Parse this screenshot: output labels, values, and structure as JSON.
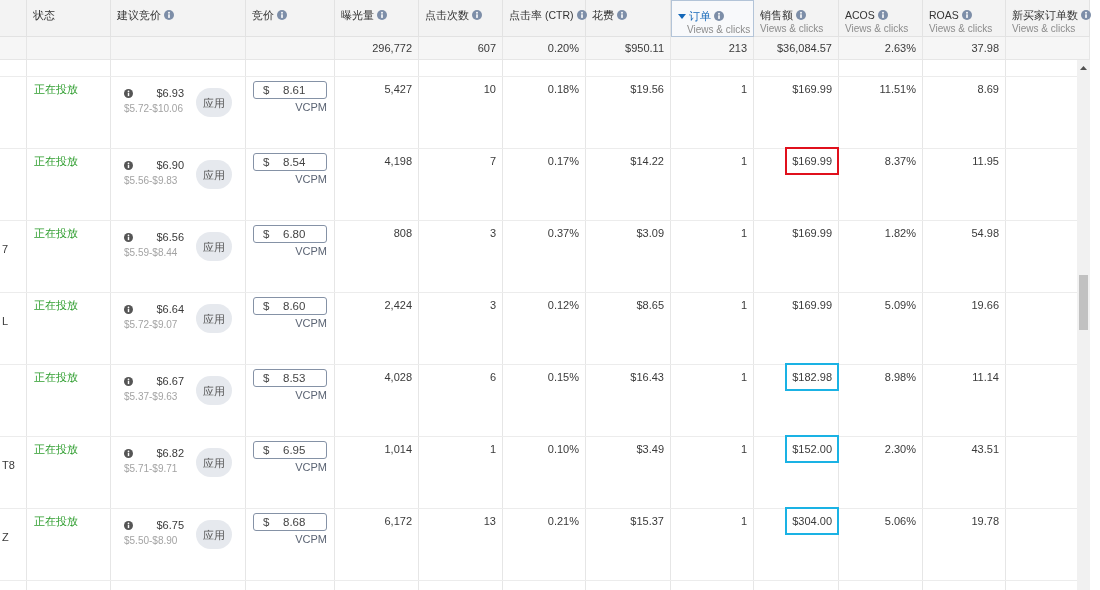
{
  "table": {
    "columns": [
      {
        "label": "状态",
        "info": false,
        "sorted": false
      },
      {
        "label": "建议竞价",
        "info": true,
        "sorted": false
      },
      {
        "label": "竞价",
        "info": true,
        "sorted": false
      },
      {
        "label": "曝光量",
        "info": true,
        "sorted": false
      },
      {
        "label": "点击次数",
        "info": true,
        "sorted": false
      },
      {
        "label": "点击率 (CTR)",
        "info": true,
        "sorted": false
      },
      {
        "label": "花费",
        "info": true,
        "sorted": false
      },
      {
        "label": "订单",
        "info": true,
        "sorted": true,
        "subtitle": "Views & clicks"
      },
      {
        "label": "销售额",
        "info": true,
        "sorted": false,
        "subtitle": "Views & clicks"
      },
      {
        "label": "ACOS",
        "info": true,
        "sorted": false,
        "subtitle": "Views & clicks"
      },
      {
        "label": "ROAS",
        "info": true,
        "sorted": false,
        "subtitle": "Views & clicks"
      },
      {
        "label": "新买家订单数",
        "info": true,
        "sorted": false,
        "subtitle": "Views & clicks"
      }
    ],
    "totals": {
      "impressions": "296,772",
      "clicks": "607",
      "ctr": "0.20%",
      "spend": "$950.11",
      "orders": "213",
      "sales": "$36,084.57",
      "acos": "2.63%",
      "roas": "37.98"
    },
    "rows": [
      {
        "status": "正在投放",
        "suggested_bid": "$6.93",
        "bid_range": "$5.72-$10.06",
        "apply_button": "应用",
        "currency": "$",
        "bid": "8.61",
        "bid_unit": "VCPM",
        "impressions": "5,427",
        "clicks": "10",
        "ctr": "0.18%",
        "spend": "$19.56",
        "orders": "1",
        "sales": "$169.99",
        "acos": "11.51%",
        "roas": "8.69"
      },
      {
        "status": "正在投放",
        "suggested_bid": "$6.90",
        "bid_range": "$5.56-$9.83",
        "apply_button": "应用",
        "currency": "$",
        "bid": "8.54",
        "bid_unit": "VCPM",
        "impressions": "4,198",
        "clicks": "7",
        "ctr": "0.17%",
        "spend": "$14.22",
        "orders": "1",
        "sales": "$169.99",
        "sales_mark": {
          "color": "#e0101c"
        },
        "acos": "8.37%",
        "roas": "11.95"
      },
      {
        "column_1": "7",
        "status": "正在投放",
        "suggested_bid": "$6.56",
        "bid_range": "$5.59-$8.44",
        "apply_button": "应用",
        "currency": "$",
        "bid": "6.80",
        "bid_unit": "VCPM",
        "impressions": "808",
        "clicks": "3",
        "ctr": "0.37%",
        "spend": "$3.09",
        "orders": "1",
        "sales": "$169.99",
        "acos": "1.82%",
        "roas": "54.98"
      },
      {
        "column_1": "L",
        "status": "正在投放",
        "suggested_bid": "$6.64",
        "bid_range": "$5.72-$9.07",
        "apply_button": "应用",
        "currency": "$",
        "bid": "8.60",
        "bid_unit": "VCPM",
        "impressions": "2,424",
        "clicks": "3",
        "ctr": "0.12%",
        "spend": "$8.65",
        "orders": "1",
        "sales": "$169.99",
        "acos": "5.09%",
        "roas": "19.66"
      },
      {
        "status": "正在投放",
        "suggested_bid": "$6.67",
        "bid_range": "$5.37-$9.63",
        "apply_button": "应用",
        "currency": "$",
        "bid": "8.53",
        "bid_unit": "VCPM",
        "impressions": "4,028",
        "clicks": "6",
        "ctr": "0.15%",
        "spend": "$16.43",
        "orders": "1",
        "sales": "$182.98",
        "sales_mark": {
          "color": "#1ab2e4"
        },
        "acos": "8.98%",
        "roas": "11.14"
      },
      {
        "column_1": "T8",
        "status": "正在投放",
        "suggested_bid": "$6.82",
        "bid_range": "$5.71-$9.71",
        "apply_button": "应用",
        "currency": "$",
        "bid": "6.95",
        "bid_unit": "VCPM",
        "impressions": "1,014",
        "clicks": "1",
        "ctr": "0.10%",
        "spend": "$3.49",
        "orders": "1",
        "sales": "$152.00",
        "sales_mark": {
          "color": "#1ab2e4"
        },
        "acos": "2.30%",
        "roas": "43.51"
      },
      {
        "column_1": "Z",
        "status": "正在投放",
        "suggested_bid": "$6.75",
        "bid_range": "$5.50-$8.90",
        "apply_button": "应用",
        "currency": "$",
        "bid": "8.68",
        "bid_unit": "VCPM",
        "impressions": "6,172",
        "clicks": "13",
        "ctr": "0.21%",
        "spend": "$15.37",
        "orders": "1",
        "sales": "$304.00",
        "sales_mark": {
          "color": "#1ab2e4"
        },
        "acos": "5.06%",
        "roas": "19.78"
      }
    ]
  }
}
